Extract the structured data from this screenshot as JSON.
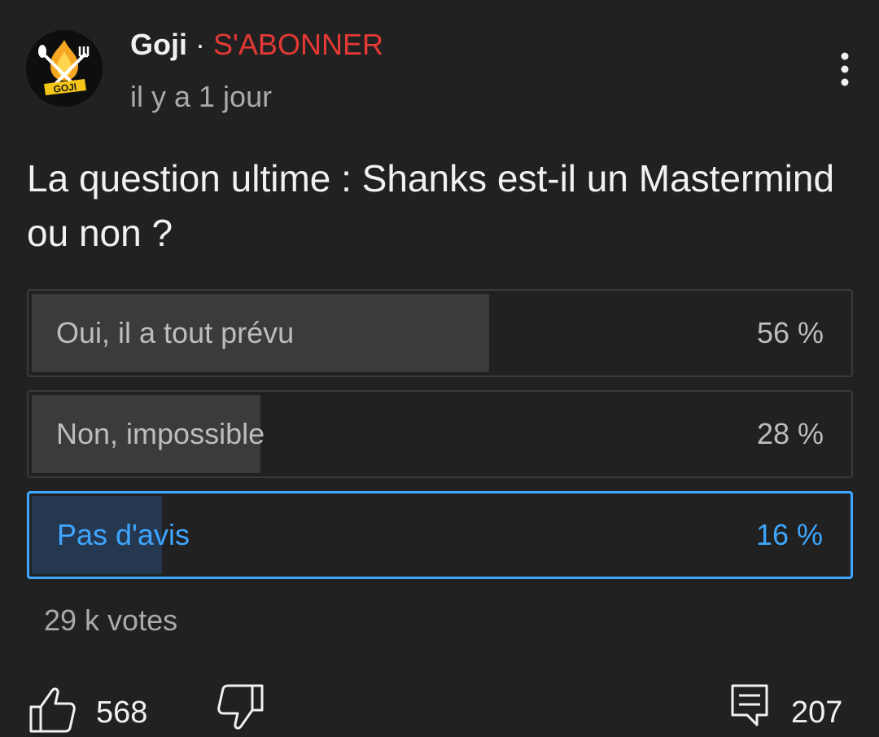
{
  "post": {
    "channel": {
      "name": "Goji",
      "separator": "·",
      "subscribe_label": "S'ABONNER",
      "avatar_text": "GOJI",
      "avatar_icon": "goji-logo-icon"
    },
    "timestamp": "il y a 1 jour",
    "menu_icon": "more-vertical-icon",
    "text": "La question ultime : Shanks est-il un Mastermind ou non ?"
  },
  "poll": {
    "options": [
      {
        "label": "Oui, il a tout prévu",
        "percent_label": "56 %",
        "percent": 56,
        "selected": false
      },
      {
        "label": "Non, impossible",
        "percent_label": "28 %",
        "percent": 28,
        "selected": false
      },
      {
        "label": "Pas d'avis",
        "percent_label": "16 %",
        "percent": 16,
        "selected": true
      }
    ],
    "votes": "29 k votes"
  },
  "actions": {
    "like_icon": "thumbs-up-icon",
    "like_count": "568",
    "dislike_icon": "thumbs-down-icon",
    "comment_icon": "comment-icon",
    "comment_count": "207"
  },
  "colors": {
    "background": "#212121",
    "subscribe": "#e53935",
    "selected_accent": "#3ea6ff",
    "selected_fill": "#263850",
    "option_fill": "#3b3b3b",
    "option_border": "#3a3a3a"
  }
}
